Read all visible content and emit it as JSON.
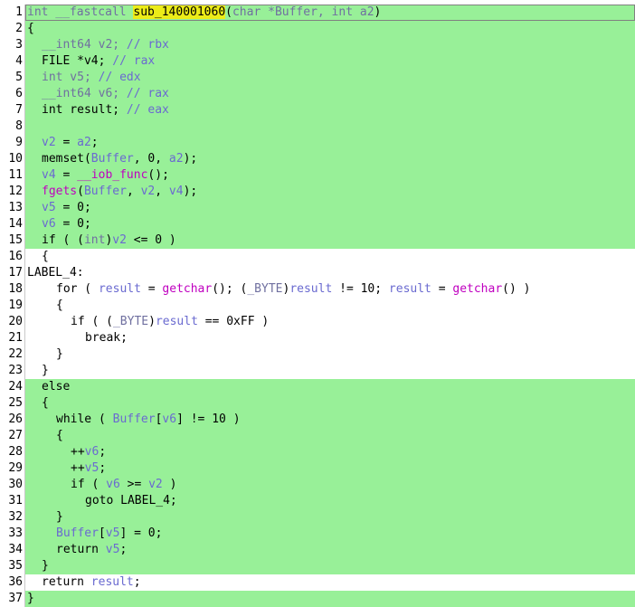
{
  "code_lines": [
    {
      "n": "1",
      "highlighted": true,
      "indent": 0,
      "tokens": [
        {
          "t": "int __fastcall ",
          "c": "type"
        },
        {
          "t": "sub_140001060",
          "c": "name-hl"
        },
        {
          "t": "(",
          "c": "plain"
        },
        {
          "t": "char *Buffer, int a2",
          "c": "type"
        },
        {
          "t": ")",
          "c": "plain"
        }
      ]
    },
    {
      "n": "2",
      "highlighted": true,
      "indent": 0,
      "tokens": [
        {
          "t": "{",
          "c": "plain"
        }
      ]
    },
    {
      "n": "3",
      "highlighted": true,
      "indent": 1,
      "tokens": [
        {
          "t": "__int64 v2; ",
          "c": "type"
        },
        {
          "t": "// rbx",
          "c": "cmt"
        }
      ]
    },
    {
      "n": "4",
      "highlighted": true,
      "indent": 1,
      "tokens": [
        {
          "t": "FILE *v4; ",
          "c": "plain"
        },
        {
          "t": "// rax",
          "c": "cmt"
        }
      ]
    },
    {
      "n": "5",
      "highlighted": true,
      "indent": 1,
      "tokens": [
        {
          "t": "int v5; ",
          "c": "type"
        },
        {
          "t": "// edx",
          "c": "cmt"
        }
      ]
    },
    {
      "n": "6",
      "highlighted": true,
      "indent": 1,
      "tokens": [
        {
          "t": "__int64 v6; ",
          "c": "type"
        },
        {
          "t": "// rax",
          "c": "cmt"
        }
      ]
    },
    {
      "n": "7",
      "highlighted": true,
      "indent": 1,
      "tokens": [
        {
          "t": "int result; ",
          "c": "plain"
        },
        {
          "t": "// eax",
          "c": "cmt"
        }
      ]
    },
    {
      "n": "8",
      "highlighted": true,
      "indent": 0,
      "tokens": []
    },
    {
      "n": "9",
      "highlighted": true,
      "indent": 1,
      "tokens": [
        {
          "t": "v2",
          "c": "var"
        },
        {
          "t": " = ",
          "c": "plain"
        },
        {
          "t": "a2",
          "c": "var"
        },
        {
          "t": ";",
          "c": "plain"
        }
      ]
    },
    {
      "n": "10",
      "highlighted": true,
      "indent": 1,
      "tokens": [
        {
          "t": "memset(",
          "c": "plain"
        },
        {
          "t": "Buffer",
          "c": "var"
        },
        {
          "t": ", 0, ",
          "c": "plain"
        },
        {
          "t": "a2",
          "c": "var"
        },
        {
          "t": ");",
          "c": "plain"
        }
      ]
    },
    {
      "n": "11",
      "highlighted": true,
      "indent": 1,
      "tokens": [
        {
          "t": "v4",
          "c": "var"
        },
        {
          "t": " = ",
          "c": "plain"
        },
        {
          "t": "__iob_func",
          "c": "func"
        },
        {
          "t": "();",
          "c": "plain"
        }
      ]
    },
    {
      "n": "12",
      "highlighted": true,
      "indent": 1,
      "tokens": [
        {
          "t": "fgets",
          "c": "func"
        },
        {
          "t": "(",
          "c": "plain"
        },
        {
          "t": "Buffer",
          "c": "var"
        },
        {
          "t": ", ",
          "c": "plain"
        },
        {
          "t": "v2",
          "c": "var"
        },
        {
          "t": ", ",
          "c": "plain"
        },
        {
          "t": "v4",
          "c": "var"
        },
        {
          "t": ");",
          "c": "plain"
        }
      ]
    },
    {
      "n": "13",
      "highlighted": true,
      "indent": 1,
      "tokens": [
        {
          "t": "v5",
          "c": "var"
        },
        {
          "t": " = 0;",
          "c": "plain"
        }
      ]
    },
    {
      "n": "14",
      "highlighted": true,
      "indent": 1,
      "tokens": [
        {
          "t": "v6",
          "c": "var"
        },
        {
          "t": " = 0;",
          "c": "plain"
        }
      ]
    },
    {
      "n": "15",
      "highlighted": true,
      "indent": 1,
      "tokens": [
        {
          "t": "if ( (",
          "c": "plain"
        },
        {
          "t": "int",
          "c": "type"
        },
        {
          "t": ")",
          "c": "plain"
        },
        {
          "t": "v2",
          "c": "var"
        },
        {
          "t": " <= 0 )",
          "c": "plain"
        }
      ]
    },
    {
      "n": "16",
      "highlighted": false,
      "indent": 1,
      "tokens": [
        {
          "t": "{",
          "c": "plain"
        }
      ]
    },
    {
      "n": "17",
      "highlighted": false,
      "indent": 0,
      "tokens": [
        {
          "t": "LABEL_4:",
          "c": "plain"
        }
      ]
    },
    {
      "n": "18",
      "highlighted": false,
      "indent": 2,
      "tokens": [
        {
          "t": "for ( ",
          "c": "plain"
        },
        {
          "t": "result",
          "c": "var"
        },
        {
          "t": " = ",
          "c": "plain"
        },
        {
          "t": "getchar",
          "c": "func"
        },
        {
          "t": "(); (",
          "c": "plain"
        },
        {
          "t": "_BYTE",
          "c": "type"
        },
        {
          "t": ")",
          "c": "plain"
        },
        {
          "t": "result",
          "c": "var"
        },
        {
          "t": " != 10; ",
          "c": "plain"
        },
        {
          "t": "result",
          "c": "var"
        },
        {
          "t": " = ",
          "c": "plain"
        },
        {
          "t": "getchar",
          "c": "func"
        },
        {
          "t": "() )",
          "c": "plain"
        }
      ]
    },
    {
      "n": "19",
      "highlighted": false,
      "indent": 2,
      "tokens": [
        {
          "t": "{",
          "c": "plain"
        }
      ]
    },
    {
      "n": "20",
      "highlighted": false,
      "indent": 3,
      "tokens": [
        {
          "t": "if ( (",
          "c": "plain"
        },
        {
          "t": "_BYTE",
          "c": "type"
        },
        {
          "t": ")",
          "c": "plain"
        },
        {
          "t": "result",
          "c": "var"
        },
        {
          "t": " == 0xFF )",
          "c": "plain"
        }
      ]
    },
    {
      "n": "21",
      "highlighted": false,
      "indent": 4,
      "tokens": [
        {
          "t": "break;",
          "c": "plain"
        }
      ]
    },
    {
      "n": "22",
      "highlighted": false,
      "indent": 2,
      "tokens": [
        {
          "t": "}",
          "c": "plain"
        }
      ]
    },
    {
      "n": "23",
      "highlighted": false,
      "indent": 1,
      "tokens": [
        {
          "t": "}",
          "c": "plain"
        }
      ]
    },
    {
      "n": "24",
      "highlighted": true,
      "indent": 1,
      "tokens": [
        {
          "t": "else",
          "c": "plain"
        }
      ]
    },
    {
      "n": "25",
      "highlighted": true,
      "indent": 1,
      "tokens": [
        {
          "t": "{",
          "c": "plain"
        }
      ]
    },
    {
      "n": "26",
      "highlighted": true,
      "indent": 2,
      "tokens": [
        {
          "t": "while ( ",
          "c": "plain"
        },
        {
          "t": "Buffer",
          "c": "var"
        },
        {
          "t": "[",
          "c": "plain"
        },
        {
          "t": "v6",
          "c": "var"
        },
        {
          "t": "] != 10 )",
          "c": "plain"
        }
      ]
    },
    {
      "n": "27",
      "highlighted": true,
      "indent": 2,
      "tokens": [
        {
          "t": "{",
          "c": "plain"
        }
      ]
    },
    {
      "n": "28",
      "highlighted": true,
      "indent": 3,
      "tokens": [
        {
          "t": "++",
          "c": "plain"
        },
        {
          "t": "v6",
          "c": "var"
        },
        {
          "t": ";",
          "c": "plain"
        }
      ]
    },
    {
      "n": "29",
      "highlighted": true,
      "indent": 3,
      "tokens": [
        {
          "t": "++",
          "c": "plain"
        },
        {
          "t": "v5",
          "c": "var"
        },
        {
          "t": ";",
          "c": "plain"
        }
      ]
    },
    {
      "n": "30",
      "highlighted": true,
      "indent": 3,
      "tokens": [
        {
          "t": "if ( ",
          "c": "plain"
        },
        {
          "t": "v6",
          "c": "var"
        },
        {
          "t": " >= ",
          "c": "plain"
        },
        {
          "t": "v2",
          "c": "var"
        },
        {
          "t": " )",
          "c": "plain"
        }
      ]
    },
    {
      "n": "31",
      "highlighted": true,
      "indent": 4,
      "tokens": [
        {
          "t": "goto LABEL_4;",
          "c": "plain"
        }
      ]
    },
    {
      "n": "32",
      "highlighted": true,
      "indent": 2,
      "tokens": [
        {
          "t": "}",
          "c": "plain"
        }
      ]
    },
    {
      "n": "33",
      "highlighted": true,
      "indent": 2,
      "tokens": [
        {
          "t": "Buffer",
          "c": "var"
        },
        {
          "t": "[",
          "c": "plain"
        },
        {
          "t": "v5",
          "c": "var"
        },
        {
          "t": "] = 0;",
          "c": "plain"
        }
      ]
    },
    {
      "n": "34",
      "highlighted": true,
      "indent": 2,
      "tokens": [
        {
          "t": "return ",
          "c": "plain"
        },
        {
          "t": "v5",
          "c": "var"
        },
        {
          "t": ";",
          "c": "plain"
        }
      ]
    },
    {
      "n": "35",
      "highlighted": true,
      "indent": 1,
      "tokens": [
        {
          "t": "}",
          "c": "plain"
        }
      ]
    },
    {
      "n": "36",
      "highlighted": false,
      "indent": 1,
      "tokens": [
        {
          "t": "return ",
          "c": "plain"
        },
        {
          "t": "result",
          "c": "var"
        },
        {
          "t": ";",
          "c": "plain"
        }
      ]
    },
    {
      "n": "37",
      "highlighted": true,
      "indent": 0,
      "tokens": [
        {
          "t": "}",
          "c": "plain"
        }
      ]
    }
  ],
  "colors": {
    "highlight_bg": "#98f098",
    "variable": "#6a6ad0",
    "function": "#c000c0",
    "name_highlight": "#ecec18"
  }
}
